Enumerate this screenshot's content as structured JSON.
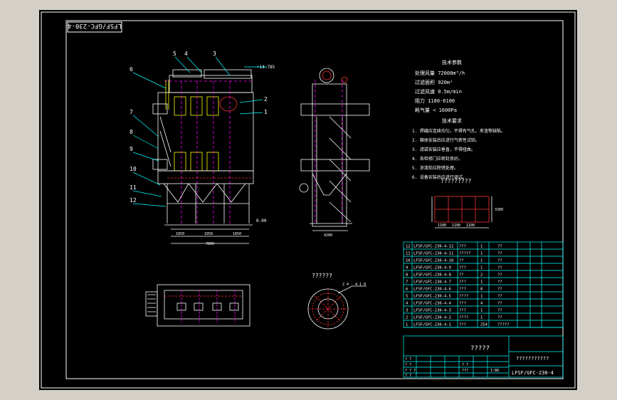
{
  "drawing": {
    "stamp": "LFSF/GFC-230-4",
    "title_code": "LFSF/GFC-230-4",
    "tech_title": "技术参数",
    "tech_params": [
      "处理风量 72000m³/h",
      "过滤面积 920m²",
      "过滤风速 0.5m/min",
      "阻力 1180-6100",
      "耗气量 < 1600Pa"
    ],
    "req_title": "技术要求",
    "requirements": [
      "1. 焊缝应连续均匀，不得有气孔、夹渣等缺陷。",
      "2. 箱体安装后应进行气密性试验。",
      "3. 滤袋安装应垂直，不得扭曲。",
      "4. 各检修门应密封良好。",
      "5. 涂漆前应除锈处理。",
      "6. 设备安装后应进行调试。"
    ],
    "grid_title": "?????????",
    "plan_title": "??????",
    "elev_marks": {
      "top": "+14.785",
      "zero": "0.00"
    },
    "callouts": [
      "5",
      "4",
      "3",
      "6",
      "2",
      "1",
      "7",
      "8",
      "9",
      "10",
      "11",
      "12"
    ],
    "dims": {
      "d1": "1850",
      "d2": "1850",
      "d3": "1850",
      "total": "7800",
      "side": "4200",
      "g1": "1100",
      "g2": "1100",
      "g3": "1100",
      "gh": "3300",
      "pipe": "2 4 - 4 1 0"
    },
    "bom": [
      {
        "no": "12",
        "code": "LFSF/GFC-230-4-12",
        "name": "???",
        "qty": "1",
        "mat": "??"
      },
      {
        "no": "11",
        "code": "LFSF/GFC-230-4-11",
        "name": "?????",
        "qty": "1",
        "mat": "??"
      },
      {
        "no": "10",
        "code": "LFSF/GFC-230-4-10",
        "name": "??",
        "qty": "1",
        "mat": "??"
      },
      {
        "no": "9",
        "code": "LFSF/GFC-230-4-9",
        "name": "???",
        "qty": "1",
        "mat": "??"
      },
      {
        "no": "8",
        "code": "LFSF/GFC-230-4-8",
        "name": "??",
        "qty": "2",
        "mat": "??"
      },
      {
        "no": "7",
        "code": "LFSF/GFC-230-4-7",
        "name": "???",
        "qty": "1",
        "mat": "??"
      },
      {
        "no": "6",
        "code": "LFSF/GFC-230-4-6",
        "name": "???",
        "qty": "8",
        "mat": "??"
      },
      {
        "no": "5",
        "code": "LFSF/GFC-230-4-5",
        "name": "????",
        "qty": "1",
        "mat": "??"
      },
      {
        "no": "4",
        "code": "LFSF/GFC-230-4-4",
        "name": "???",
        "qty": "4",
        "mat": "??"
      },
      {
        "no": "3",
        "code": "LFSF/GFC-230-4-3",
        "name": "???",
        "qty": "1",
        "mat": "??"
      },
      {
        "no": "2",
        "code": "LFSF/GFC-230-4-2",
        "name": "????",
        "qty": "1",
        "mat": "??"
      },
      {
        "no": "1",
        "code": "LFSF/GFC-230-4-1",
        "name": "???",
        "qty": "254",
        "mat": "?????"
      }
    ],
    "title_main": "?????",
    "title_company": "???????????",
    "scale": "1:80",
    "title_small": [
      "? ?",
      "? ?",
      "? ? ?",
      "? ?",
      "? ?",
      "???"
    ]
  },
  "colors": {
    "viewport_bg": "#000000",
    "window_bg": "#d4d0c8"
  }
}
